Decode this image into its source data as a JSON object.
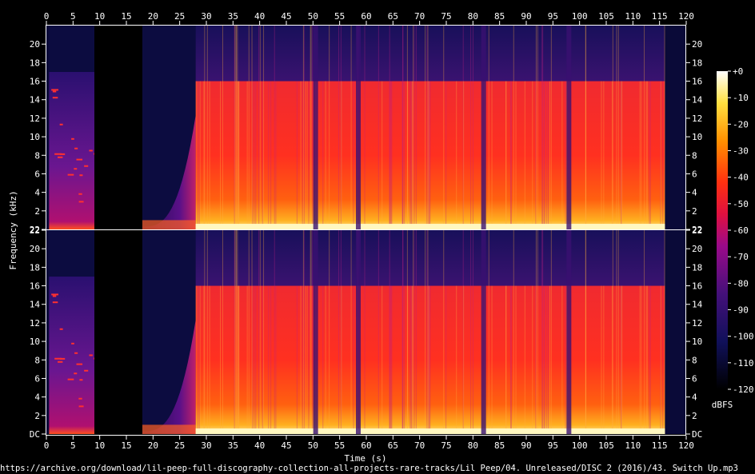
{
  "chart_data": {
    "type": "heatmap",
    "xlabel": "Time (s)",
    "ylabel": "Frequency (kHz)",
    "x_ticks": [
      0,
      5,
      10,
      15,
      20,
      25,
      30,
      35,
      40,
      45,
      50,
      55,
      60,
      65,
      70,
      75,
      80,
      85,
      90,
      95,
      100,
      105,
      110,
      115,
      120
    ],
    "xlim": [
      0,
      120
    ],
    "y_ticks": [
      "2",
      "4",
      "6",
      "8",
      "10",
      "12",
      "14",
      "16",
      "18",
      "20",
      "22"
    ],
    "y_bottom_label_top_channel": "22",
    "y_bottom_label_bottom_channel": "DC",
    "ylim_khz": [
      0,
      22
    ],
    "colorbar": {
      "label": "dBFS",
      "ticks": [
        "+0",
        "-10",
        "-20",
        "-30",
        "-40",
        "-50",
        "-60",
        "-70",
        "-80",
        "-90",
        "-100",
        "-110",
        "-120"
      ],
      "range_db": [
        -120,
        0
      ]
    },
    "channels": 2,
    "source_path": "https://archive.org/download/lil-peep-full-discography-collection-all-projects-rare-tracks/Lil Peep/04. Unreleased/DISC 2 (2016)/43. Switch Up.mp3",
    "segments": [
      {
        "start_s": 0.5,
        "end_s": 9,
        "description": "quiet intro",
        "max_khz": 17,
        "level_db": -90
      },
      {
        "start_s": 9,
        "end_s": 18,
        "description": "silence",
        "max_khz": 0,
        "level_db": -120
      },
      {
        "start_s": 18,
        "end_s": 28,
        "description": "fade-in",
        "max_khz": 12,
        "level_db": -75
      },
      {
        "start_s": 28,
        "end_s": 116,
        "description": "full band",
        "max_khz": 16,
        "level_db": -50
      }
    ],
    "dropouts_s": [
      50.5,
      58.5,
      82,
      98
    ]
  }
}
